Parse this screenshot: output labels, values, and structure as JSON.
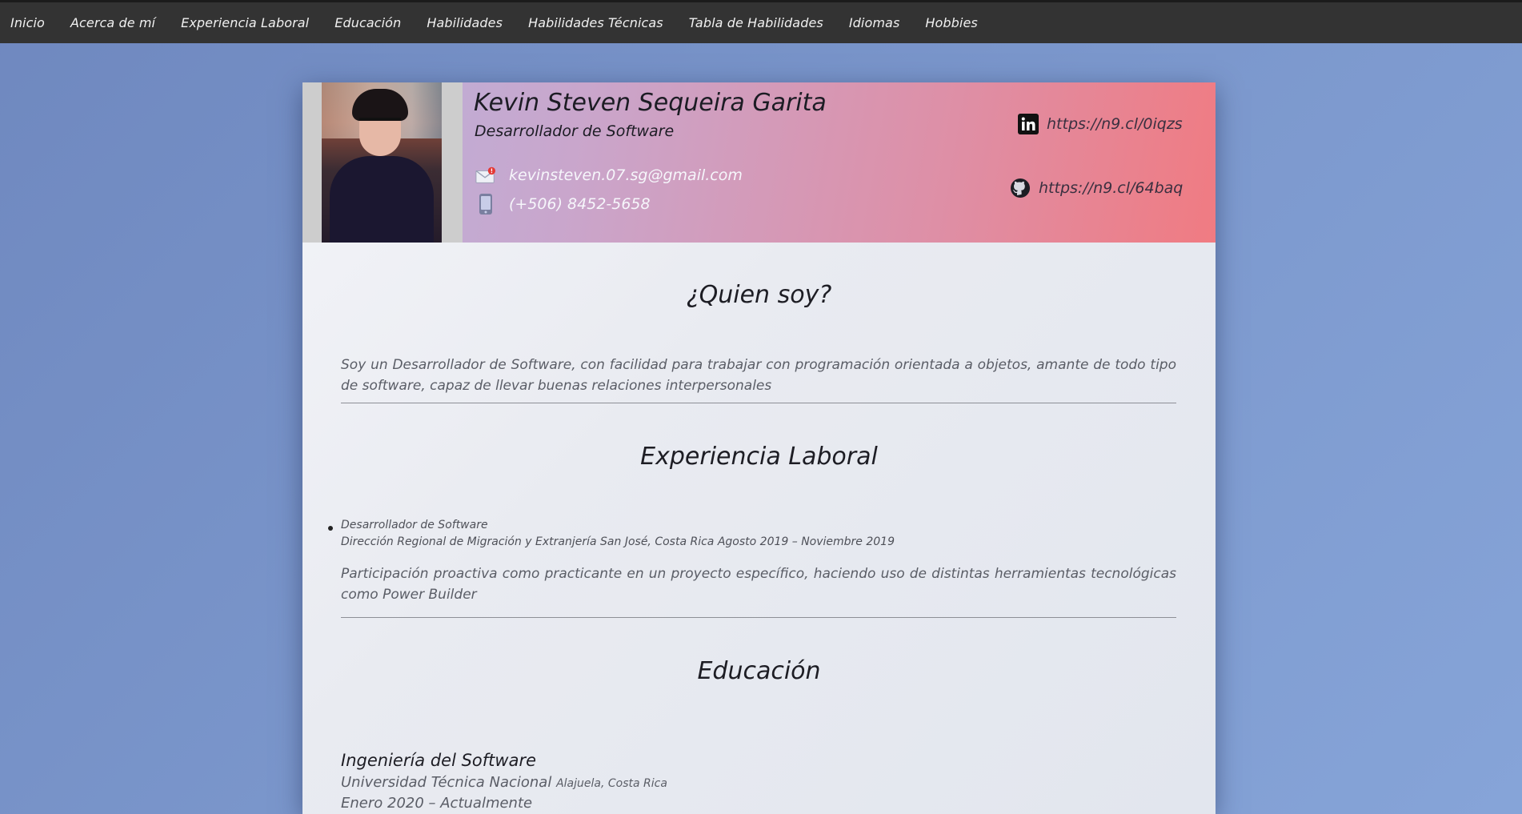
{
  "nav": {
    "items": [
      "Inicio",
      "Acerca de mí",
      "Experiencia Laboral",
      "Educación",
      "Habilidades",
      "Habilidades Técnicas",
      "Tabla de Habilidades",
      "Idiomas",
      "Hobbies"
    ]
  },
  "profile": {
    "name": "Kevin Steven Sequeira Garita",
    "role": "Desarrollador de Software",
    "email": "kevinsteven.07.sg@gmail.com",
    "phone": "(+506) 8452-5658",
    "linkedin": "https://n9.cl/0iqzs",
    "github": "https://n9.cl/64baq"
  },
  "about": {
    "title": "¿Quien soy?",
    "text": "Soy un Desarrollador de Software, con facilidad para trabajar con programación orientada a objetos, amante de todo tipo de software, capaz de llevar buenas relaciones interpersonales"
  },
  "experience": {
    "title": "Experiencia Laboral",
    "items": [
      {
        "position": "Desarrollador de Software",
        "details": "Dirección Regional de Migración y Extranjería San José, Costa Rica Agosto 2019 – Noviembre 2019",
        "description": "Participación proactiva como practicante en un proyecto específico, haciendo uso de distintas herramientas tecnológicas como Power Builder"
      }
    ]
  },
  "education": {
    "title": "Educación",
    "items": [
      {
        "degree": "Ingeniería del Software",
        "institution": "Universidad Técnica Nacional",
        "location": "Alajuela, Costa Rica",
        "period": "Enero 2020 – Actualmente"
      }
    ]
  },
  "colors": {
    "background": "#7b97cc",
    "navbar": "#333333",
    "header_gradient_start": "#b9b2dc",
    "header_gradient_end": "#f07b82",
    "email_badge": "#e53935"
  },
  "icons": [
    "mail-icon",
    "phone-icon",
    "linkedin-icon",
    "github-icon"
  ]
}
